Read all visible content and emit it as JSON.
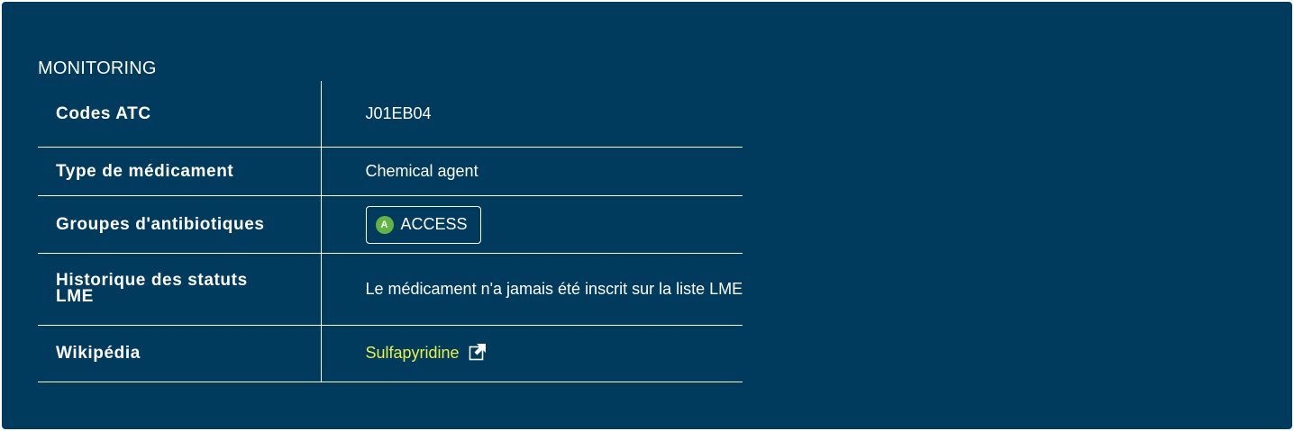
{
  "section": {
    "title": "MONITORING"
  },
  "rows": [
    {
      "key": "Codes ATC",
      "value": "J01EB04"
    },
    {
      "key": "Type de médicament",
      "value": "Chemical agent"
    },
    {
      "key": "Groupes d'antibiotiques",
      "badge_letter": "A",
      "badge_label": "ACCESS"
    },
    {
      "key": "Historique des statuts LME",
      "value": "Le médicament n'a jamais été inscrit sur la liste LME"
    },
    {
      "key": "Wikipédia",
      "link_text": "Sulfapyridine",
      "icon": "external-link-icon"
    }
  ],
  "colors": {
    "background": "#003a5d",
    "text": "#ffffff",
    "link": "#e8f04a",
    "access_badge": "#64b445"
  }
}
